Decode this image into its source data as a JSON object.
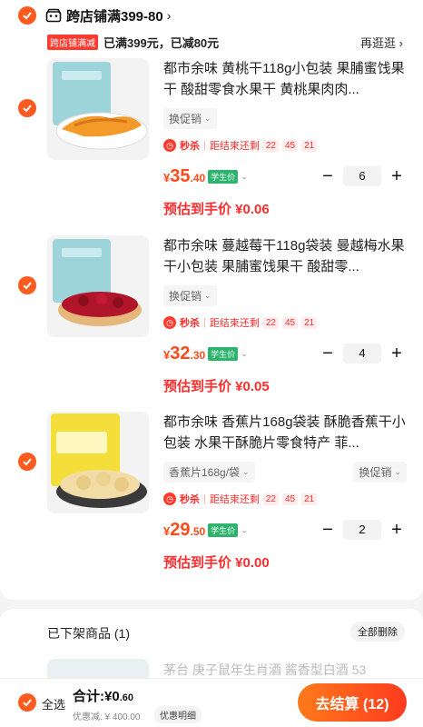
{
  "store": {
    "name": "跨店铺满399-80"
  },
  "promo": {
    "tag": "跨店铺满减",
    "text": "已满399元，已减80元",
    "link": "再逛逛"
  },
  "items": [
    {
      "title": "都市余味 黄桃干118g小包装 果脯蜜饯果干 酸甜零食水果干 黄桃果肉肉...",
      "spec": "",
      "promo_select": "换促销",
      "flash_label": "秒杀",
      "countdown_label": "距结束还剩",
      "countdown": [
        "22",
        "45",
        "21"
      ],
      "price_symbol": "¥",
      "price_int": "35",
      "price_dec": ".40",
      "student_badge": "学生价",
      "quantity": "6",
      "final_price": "预估到手价 ¥0.06"
    },
    {
      "title": "都市余味 蔓越莓干118g袋装 曼越梅水果干小包装 果脯蜜饯果干 酸甜零...",
      "spec": "",
      "promo_select": "换促销",
      "flash_label": "秒杀",
      "countdown_label": "距结束还剩",
      "countdown": [
        "22",
        "45",
        "21"
      ],
      "price_symbol": "¥",
      "price_int": "32",
      "price_dec": ".30",
      "student_badge": "学生价",
      "quantity": "4",
      "final_price": "预估到手价 ¥0.05"
    },
    {
      "title": "都市余味 香蕉片168g袋装 酥脆香蕉干小包装 水果干酥脆片零食特产 菲...",
      "spec": "香蕉片168g/袋",
      "promo_select": "换促销",
      "flash_label": "秒杀",
      "countdown_label": "距结束还剩",
      "countdown": [
        "22",
        "45",
        "21"
      ],
      "price_symbol": "¥",
      "price_int": "29",
      "price_dec": ".50",
      "student_badge": "学生价",
      "quantity": "2",
      "final_price": "预估到手价 ¥0.00"
    }
  ],
  "offshelf": {
    "heading": "已下架商品 (1)",
    "clear_all": "全部删除",
    "item_title": "茅台 庚子鼠年生肖酒 酱香型白酒 53"
  },
  "footer": {
    "select_all": "全选",
    "total_label": "合计:",
    "total_int": "¥0",
    "total_dec": ".60",
    "discount": "优惠减: ¥ 400.00",
    "detail_btn": "优惠明细",
    "checkout": "去结算 (12)"
  },
  "colors": {
    "accent": "#ff5a1f",
    "price": "#ff4a1a",
    "student": "#2cb46d"
  }
}
